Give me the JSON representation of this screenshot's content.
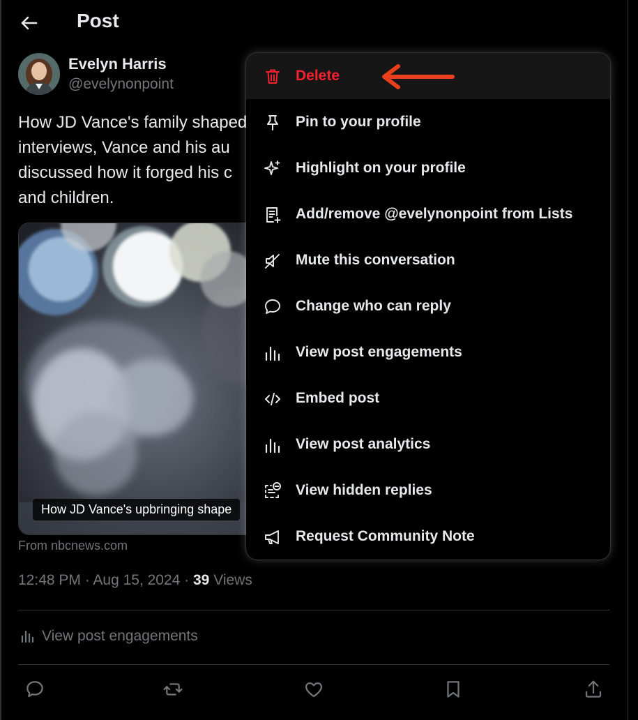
{
  "header": {
    "title": "Post"
  },
  "post": {
    "author_name": "Evelyn Harris",
    "author_handle": "@evelynonpoint",
    "text_lines": [
      "How JD Vance's family shaped",
      "interviews, Vance and his au",
      "discussed how it forged his c",
      "and children."
    ],
    "media_caption": "How JD Vance's upbringing shape",
    "source": "From nbcnews.com",
    "time": "12:48 PM · Aug 15, 2024 · ",
    "views_count": "39",
    "views_label": " Views",
    "engagements_link": "View post engagements"
  },
  "menu": {
    "items": [
      {
        "label": "Delete",
        "icon": "trash-icon"
      },
      {
        "label": "Pin to your profile",
        "icon": "pin-icon"
      },
      {
        "label": "Highlight on your profile",
        "icon": "sparkle-icon"
      },
      {
        "label": "Add/remove @evelynonpoint from Lists",
        "icon": "list-add-icon"
      },
      {
        "label": "Mute this conversation",
        "icon": "mute-icon"
      },
      {
        "label": "Change who can reply",
        "icon": "speech-bubble-icon"
      },
      {
        "label": "View post engagements",
        "icon": "bar-chart-icon"
      },
      {
        "label": "Embed post",
        "icon": "code-icon"
      },
      {
        "label": "View post analytics",
        "icon": "bar-chart-icon"
      },
      {
        "label": "View hidden replies",
        "icon": "hidden-replies-icon"
      },
      {
        "label": "Request Community Note",
        "icon": "megaphone-icon"
      }
    ]
  },
  "colors": {
    "background": "#000000",
    "text": "#e7e9ea",
    "secondary_text": "#71767b",
    "danger": "#f4212e",
    "annotation_arrow": "#e8401c"
  }
}
